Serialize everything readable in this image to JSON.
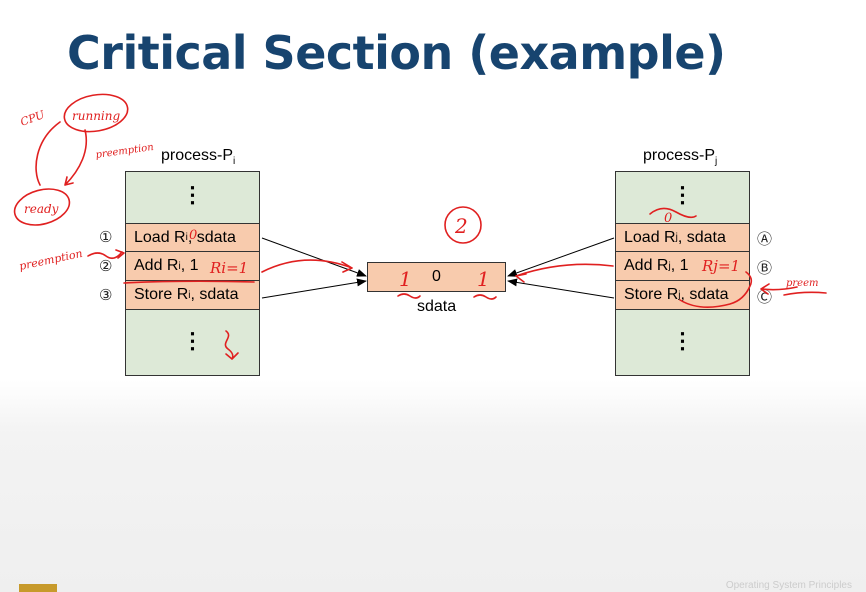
{
  "slide": {
    "title": "Critical Section (example)",
    "footer": "Operating System Principles"
  },
  "left_process": {
    "label": "process-P",
    "label_sub": "i",
    "dots_top": "⋮",
    "dots_bottom": "⋮",
    "steps": [
      {
        "marker": "①",
        "pre": "Load R",
        "sub": "i",
        "post": ", sdata"
      },
      {
        "marker": "②",
        "pre": "Add R",
        "sub": "i",
        "post": ", 1"
      },
      {
        "marker": "③",
        "pre": "Store R",
        "sub": "i",
        "post": ", sdata"
      }
    ]
  },
  "right_process": {
    "label": "process-P",
    "label_sub": "j",
    "dots_top": "⋮",
    "dots_bottom": "⋮",
    "steps": [
      {
        "marker": "Ⓐ",
        "pre": "Load R",
        "sub": "j",
        "post": ", sdata"
      },
      {
        "marker": "Ⓑ",
        "pre": "Add R",
        "sub": "j",
        "post": ", 1"
      },
      {
        "marker": "Ⓒ",
        "pre": "Store R",
        "sub": "j",
        "post": ", sdata"
      }
    ]
  },
  "shared": {
    "value": "0",
    "label": "sdata"
  },
  "annotations": {
    "cpu": "CPU",
    "running": "running",
    "preemption_top": "preemption",
    "ready": "ready",
    "preemption_left": "preemption",
    "circled_two": "2",
    "ri_zero": "0",
    "ri_eq": "Ri=1",
    "rj_zero": "0",
    "rj_eq": "Rj=1",
    "left_one": "1",
    "right_one": "1",
    "right_word": "preem"
  },
  "colors": {
    "title": "#17446f",
    "green_block": "#dde9d7",
    "orange_block": "#f8cbad",
    "ink": "#e02020"
  }
}
